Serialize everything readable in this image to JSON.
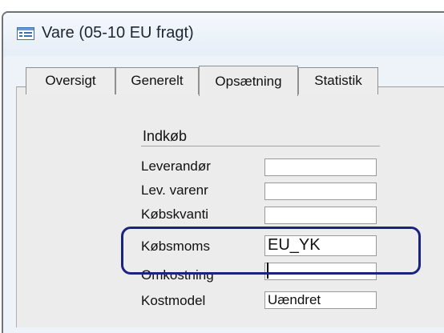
{
  "window": {
    "title": "Vare (05-10  EU fragt)",
    "icon": "form-window-icon"
  },
  "tabs": [
    {
      "label": "Oversigt",
      "active": false
    },
    {
      "label": "Generelt",
      "active": false
    },
    {
      "label": "Opsætning",
      "active": true
    },
    {
      "label": "Statistik",
      "active": false
    }
  ],
  "section": {
    "title": "Indkøb",
    "fields": [
      {
        "label": "Leverandør",
        "value": ""
      },
      {
        "label": "Lev. varenr",
        "value": ""
      },
      {
        "label": "Købskvanti",
        "value": ""
      },
      {
        "label": "Købsmoms",
        "value": "EU_YK"
      },
      {
        "label": "Omkostning",
        "value": ""
      },
      {
        "label": "Kostmodel",
        "value": "Uændret"
      }
    ]
  },
  "colors": {
    "highlight_border": "#1a237e"
  }
}
